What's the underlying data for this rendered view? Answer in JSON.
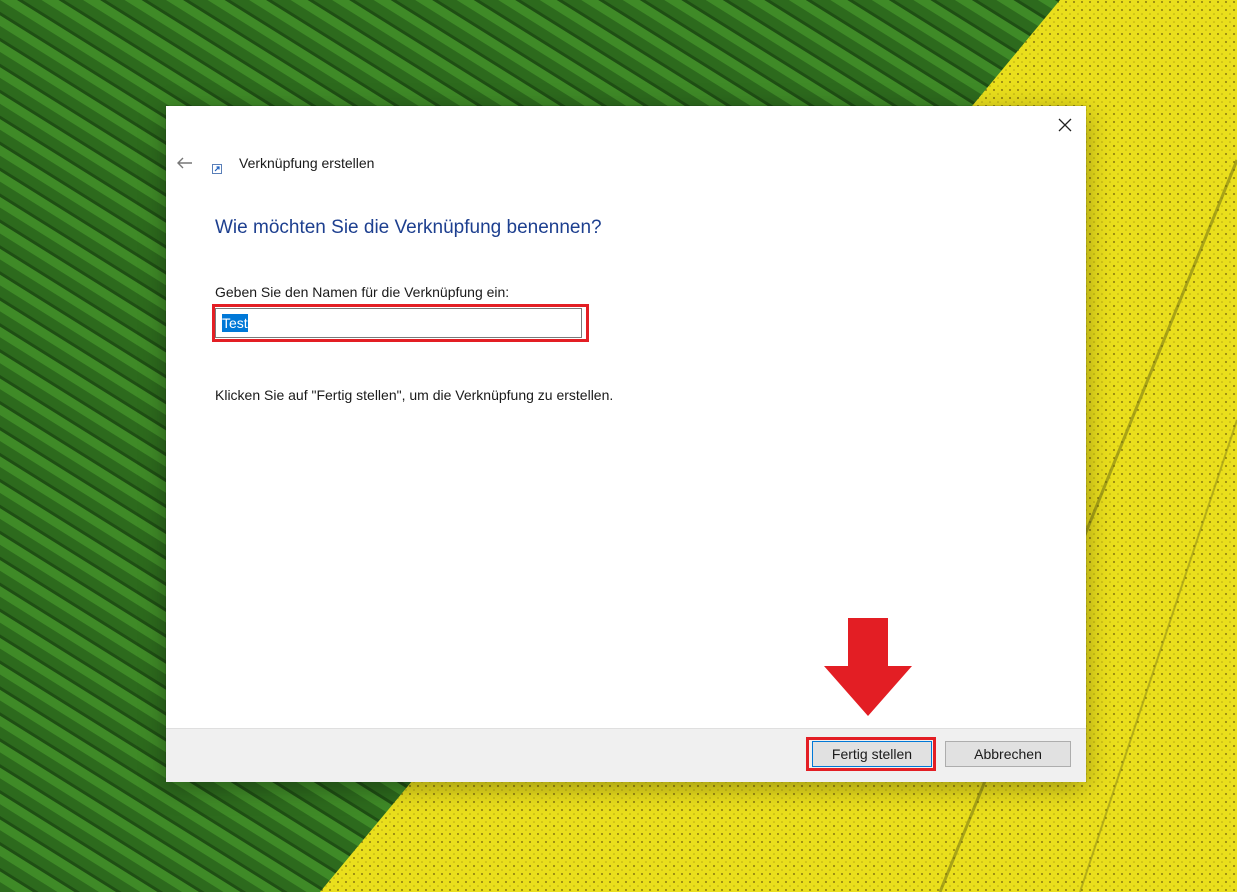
{
  "wizard": {
    "title": "Verknüpfung erstellen",
    "heading": "Wie möchten Sie die Verknüpfung benennen?",
    "name_label": "Geben Sie den Namen für die Verknüpfung ein:",
    "name_value": "Test",
    "hint": "Klicken Sie auf \"Fertig stellen\", um die Verknüpfung zu erstellen.",
    "icons": {
      "back": "back-arrow-icon",
      "close": "close-icon",
      "shortcut": "shortcut-icon"
    }
  },
  "footer": {
    "finish_label": "Fertig stellen",
    "cancel_label": "Abbrechen"
  },
  "annotations": {
    "highlight_color": "#e31e24",
    "arrow_color": "#e31e24"
  },
  "colors": {
    "heading": "#1d3f8f",
    "selection": "#0078d7",
    "wallpaper_green": "#2f6b1f",
    "wallpaper_yellow": "#e8e01a"
  }
}
